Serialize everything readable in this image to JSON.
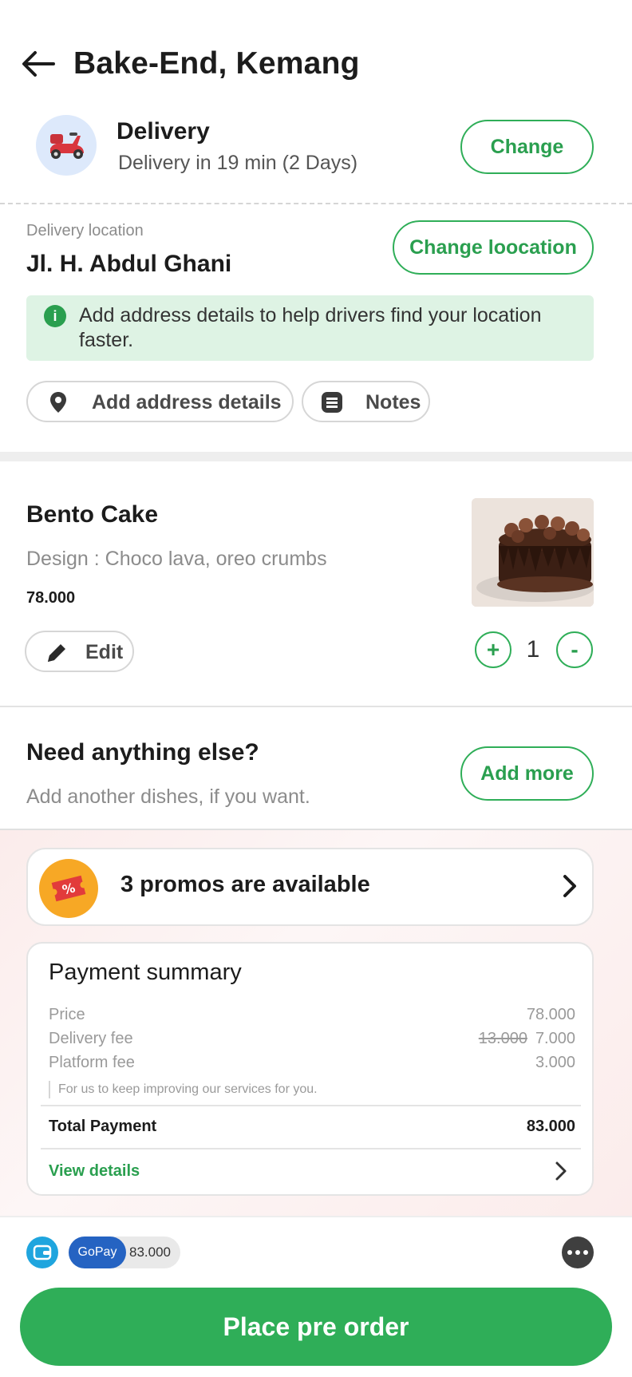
{
  "header": {
    "title": "Bake-End, Kemang",
    "back_icon": "arrow-left-icon"
  },
  "delivery": {
    "title": "Delivery",
    "subtitle": "Delivery in 19 min (2 Days)",
    "change_label": "Change",
    "icon": "scooter-icon"
  },
  "location": {
    "label": "Delivery location",
    "value": "Jl. H. Abdul Ghani",
    "change_label": "Change loocation",
    "info_text": "Add address details to help drivers find your location faster.",
    "chips": {
      "address": "Add address details",
      "notes": "Notes"
    }
  },
  "item": {
    "name": "Bento Cake",
    "description": "Design : Choco lava, oreo crumbs",
    "price": "78.000",
    "edit_label": "Edit",
    "quantity": "1",
    "plus": "+",
    "minus": "-"
  },
  "need_more": {
    "title": "Need anything else?",
    "subtitle": "Add another dishes, if you want.",
    "button": "Add more"
  },
  "promo": {
    "text": "3 promos are available",
    "icon": "ticket-percent-icon"
  },
  "payment": {
    "title": "Payment summary",
    "price_label": "Price",
    "price_value": "78.000",
    "delivery_label": "Delivery fee",
    "delivery_old": "13.000",
    "delivery_value": "7.000",
    "platform_label": "Platform fee",
    "platform_value": "3.000",
    "platform_note": "For us to keep improving our services for you.",
    "total_label": "Total Payment",
    "total_value": "83.000",
    "view_details": "View details"
  },
  "bottom": {
    "wallet_name": "GoPay",
    "wallet_amount": "83.000",
    "cta": "Place pre order"
  },
  "colors": {
    "accent": "#2fae58",
    "info_bg": "#def3e4",
    "gopay": "#2563c2",
    "promo": "#f7a825"
  }
}
